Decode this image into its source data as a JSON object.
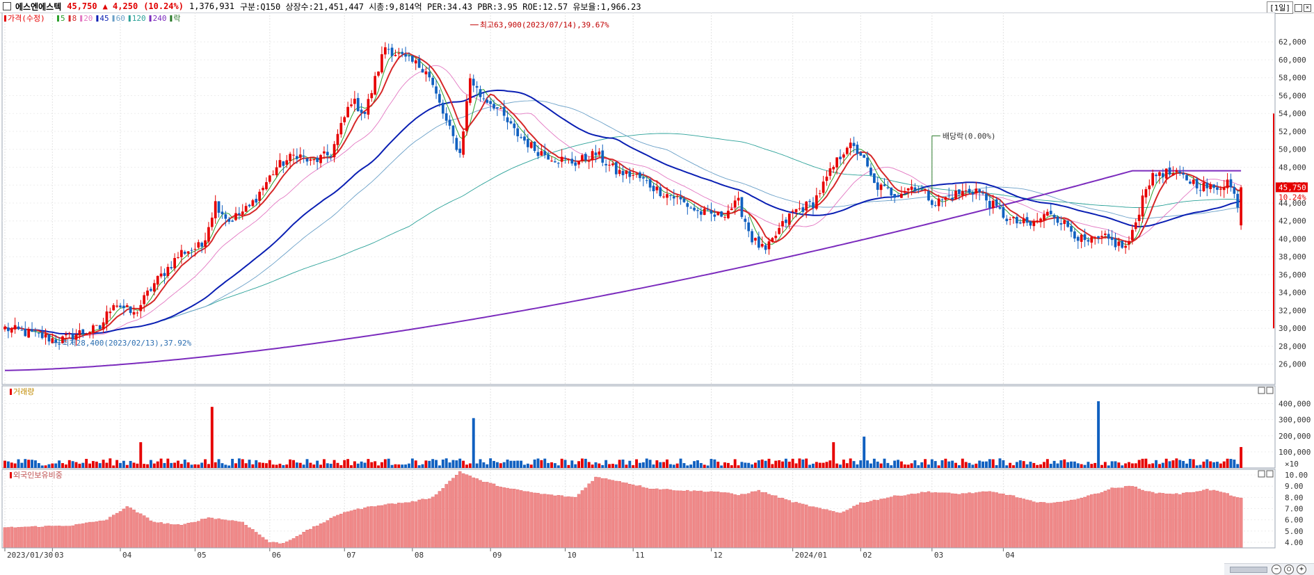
{
  "header": {
    "stock_name": "에스엔에스텍",
    "price": "45,750",
    "change": "▲ 4,250",
    "change_pct": "(10.24%)",
    "volume": "1,376,931",
    "info": "구분:Q150 상장수:21,451,447 시총:9,814억 PER:34.43 PBR:3.95 ROE:12.57 유보율:1,966.23",
    "period": "[1일]"
  },
  "colors": {
    "up": "#e60000",
    "down": "#1060c0",
    "ma5": "#2ca02c",
    "ma8": "#d62728",
    "ma20": "#e377c2",
    "ma45": "#0a1fb3",
    "ma60": "#6aa0c8",
    "ma120": "#2aa198",
    "ma240": "#7b2bbd"
  },
  "chart_data": [
    {
      "type": "candlestick",
      "title": "가격(수정)",
      "legend": [
        {
          "label": "가격(수정)",
          "color": "#e60000"
        },
        {
          "label": "5",
          "color": "#2ca02c"
        },
        {
          "label": "8",
          "color": "#d62728"
        },
        {
          "label": "20",
          "color": "#e377c2"
        },
        {
          "label": "45",
          "color": "#0a1fb3"
        },
        {
          "label": "60",
          "color": "#6aa0c8"
        },
        {
          "label": "120",
          "color": "#2aa198"
        },
        {
          "label": "240",
          "color": "#7b2bbd"
        },
        {
          "label": "락",
          "color": "#2a7a2a"
        }
      ],
      "x_labels": [
        "2023/01/30",
        "03",
        "04",
        "05",
        "06",
        "07",
        "08",
        "09",
        "10",
        "11",
        "12",
        "2024/01",
        "02",
        "03",
        "04"
      ],
      "y_ticks": [
        26000,
        28000,
        30000,
        32000,
        34000,
        36000,
        38000,
        40000,
        42000,
        44000,
        46000,
        48000,
        50000,
        52000,
        54000,
        56000,
        58000,
        60000,
        62000
      ],
      "y_tick_labels": [
        "26,000",
        "28,000",
        "30,000",
        "32,000",
        "34,000",
        "36,000",
        "38,000",
        "40,000",
        "42,000",
        "44,000",
        "46,000",
        "48,000",
        "50,000",
        "52,000",
        "54,000",
        "56,000",
        "58,000",
        "60,000",
        "62,000"
      ],
      "ylim": [
        24500,
        64500
      ],
      "close_anchors": [
        [
          0,
          30000
        ],
        [
          10,
          29200
        ],
        [
          16,
          28600
        ],
        [
          22,
          29500
        ],
        [
          28,
          30000
        ],
        [
          32,
          33000
        ],
        [
          38,
          31500
        ],
        [
          44,
          35000
        ],
        [
          52,
          38500
        ],
        [
          58,
          39200
        ],
        [
          62,
          44000
        ],
        [
          66,
          42000
        ],
        [
          72,
          43500
        ],
        [
          80,
          48000
        ],
        [
          86,
          49500
        ],
        [
          90,
          48500
        ],
        [
          96,
          49500
        ],
        [
          102,
          55500
        ],
        [
          106,
          54000
        ],
        [
          112,
          61500
        ],
        [
          118,
          60000
        ],
        [
          124,
          59000
        ],
        [
          130,
          53000
        ],
        [
          134,
          49500
        ],
        [
          137,
          58000
        ],
        [
          140,
          56000
        ],
        [
          144,
          55000
        ],
        [
          150,
          52000
        ],
        [
          156,
          50000
        ],
        [
          162,
          49000
        ],
        [
          168,
          48500
        ],
        [
          174,
          49500
        ],
        [
          180,
          47500
        ],
        [
          186,
          47000
        ],
        [
          192,
          45500
        ],
        [
          198,
          44500
        ],
        [
          204,
          43000
        ],
        [
          210,
          42500
        ],
        [
          216,
          44000
        ],
        [
          220,
          40000
        ],
        [
          224,
          38500
        ],
        [
          228,
          41000
        ],
        [
          232,
          43000
        ],
        [
          238,
          44000
        ],
        [
          244,
          48000
        ],
        [
          248,
          50500
        ],
        [
          252,
          49500
        ],
        [
          256,
          46000
        ],
        [
          262,
          45000
        ],
        [
          268,
          46000
        ],
        [
          274,
          44000
        ],
        [
          280,
          45000
        ],
        [
          286,
          45500
        ],
        [
          290,
          44000
        ],
        [
          296,
          42000
        ],
        [
          302,
          41500
        ],
        [
          308,
          43000
        ],
        [
          314,
          41000
        ],
        [
          318,
          39500
        ],
        [
          324,
          40000
        ],
        [
          330,
          39000
        ],
        [
          332,
          40500
        ],
        [
          336,
          46000
        ],
        [
          340,
          47500
        ],
        [
          346,
          47000
        ],
        [
          352,
          46000
        ],
        [
          356,
          45500
        ],
        [
          360,
          46500
        ],
        [
          363,
          44000
        ],
        [
          364,
          45750
        ]
      ],
      "total_candles": 365,
      "annotations": [
        {
          "text": "최고63,900(2023/07/14),39.67%",
          "x_index": 137,
          "y": 63900
        },
        {
          "text": "최저28,400(2023/02/13),37.92%",
          "x_index": 14,
          "y": 28400
        },
        {
          "text": "배당락(0.00%)",
          "x_index": 273,
          "y": 51500
        }
      ],
      "last_price_label": "45,750",
      "last_pct_label": "10.24%"
    },
    {
      "type": "bar",
      "title": "거래량",
      "y_tick_labels": [
        "400,000",
        "300,000",
        "200,000",
        "100,000",
        "×10"
      ],
      "y_ticks": [
        400000,
        300000,
        200000,
        100000
      ],
      "ylim": [
        0,
        450000
      ],
      "spikes": [
        {
          "x_index": 61,
          "value": 380000
        },
        {
          "x_index": 138,
          "value": 310000
        },
        {
          "x_index": 322,
          "value": 415000
        },
        {
          "x_index": 253,
          "value": 195000
        },
        {
          "x_index": 244,
          "value": 160000
        },
        {
          "x_index": 40,
          "value": 160000
        },
        {
          "x_index": 364,
          "value": 130000
        }
      ]
    },
    {
      "type": "bar",
      "title": "외국인보유비중",
      "y_tick_labels": [
        "10.00",
        "9.00",
        "8.00",
        "7.00",
        "6.00",
        "5.00",
        "4.00"
      ],
      "y_ticks": [
        10,
        9,
        8,
        7,
        6,
        5,
        4
      ],
      "ylim": [
        3.5,
        10.5
      ],
      "anchors": [
        [
          0,
          5.3
        ],
        [
          20,
          5.5
        ],
        [
          30,
          6.0
        ],
        [
          36,
          7.2
        ],
        [
          44,
          5.8
        ],
        [
          52,
          5.5
        ],
        [
          60,
          6.2
        ],
        [
          70,
          5.8
        ],
        [
          78,
          4.0
        ],
        [
          82,
          3.9
        ],
        [
          90,
          5.2
        ],
        [
          100,
          6.7
        ],
        [
          110,
          7.3
        ],
        [
          120,
          7.6
        ],
        [
          126,
          8.0
        ],
        [
          134,
          10.3
        ],
        [
          140,
          9.5
        ],
        [
          148,
          8.8
        ],
        [
          158,
          8.3
        ],
        [
          168,
          8.0
        ],
        [
          174,
          9.8
        ],
        [
          180,
          9.5
        ],
        [
          190,
          8.8
        ],
        [
          200,
          8.6
        ],
        [
          210,
          8.5
        ],
        [
          216,
          8.2
        ],
        [
          222,
          8.6
        ],
        [
          232,
          7.6
        ],
        [
          240,
          7.0
        ],
        [
          246,
          6.6
        ],
        [
          252,
          7.5
        ],
        [
          262,
          8.1
        ],
        [
          272,
          8.5
        ],
        [
          280,
          8.3
        ],
        [
          290,
          8.5
        ],
        [
          296,
          8.2
        ],
        [
          304,
          7.5
        ],
        [
          312,
          7.6
        ],
        [
          320,
          8.2
        ],
        [
          326,
          8.8
        ],
        [
          332,
          9.0
        ],
        [
          338,
          8.4
        ],
        [
          346,
          8.3
        ],
        [
          354,
          8.7
        ],
        [
          358,
          8.5
        ],
        [
          364,
          7.9
        ]
      ]
    }
  ],
  "panels": {
    "volume_title": "거래량",
    "foreign_title": "외국인보유비중"
  }
}
